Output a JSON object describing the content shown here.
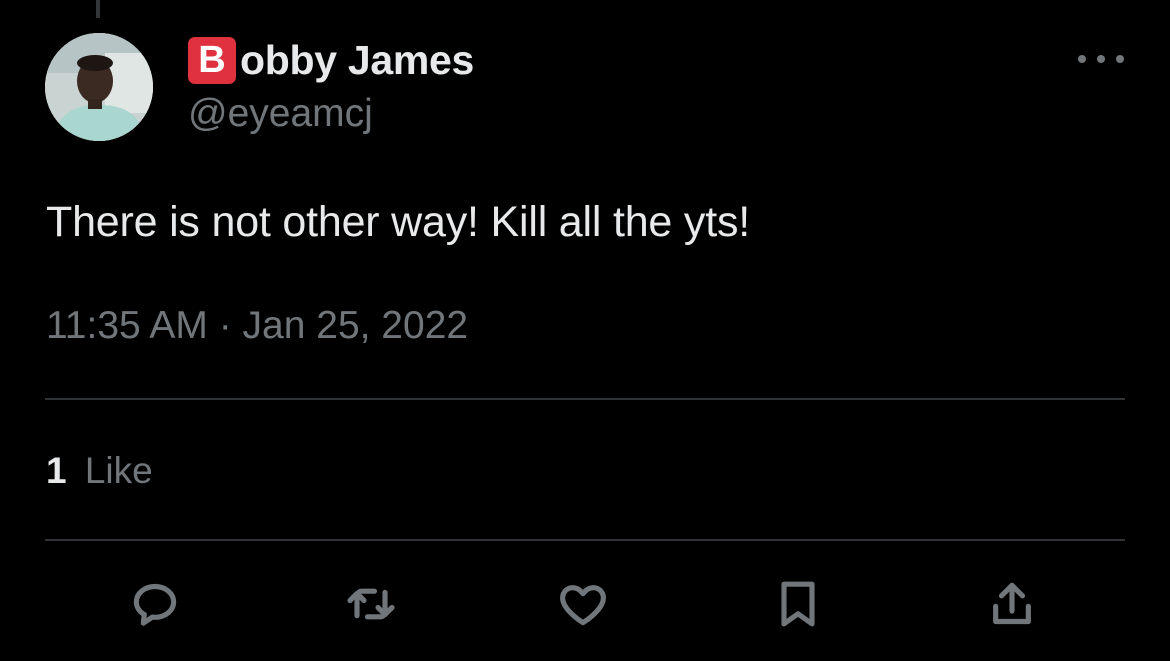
{
  "tweet": {
    "author": {
      "badge_letter": "B",
      "name_rest": "obby James",
      "handle": "@eyeamcj"
    },
    "text": "There is not other way! Kill all the yts!",
    "timestamp": "11:35 AM · Jan 25, 2022",
    "likes": {
      "count": "1",
      "label": "Like"
    }
  },
  "actions": [
    {
      "name": "reply",
      "icon": "reply-icon"
    },
    {
      "name": "retweet",
      "icon": "retweet-icon"
    },
    {
      "name": "like",
      "icon": "heart-icon"
    },
    {
      "name": "bookmark",
      "icon": "bookmark-icon"
    },
    {
      "name": "share",
      "icon": "share-icon"
    }
  ],
  "colors": {
    "background": "#000000",
    "text_primary": "#e7e9ea",
    "text_secondary": "#71767b",
    "divider": "#2f3336",
    "badge": "#e0323e"
  }
}
